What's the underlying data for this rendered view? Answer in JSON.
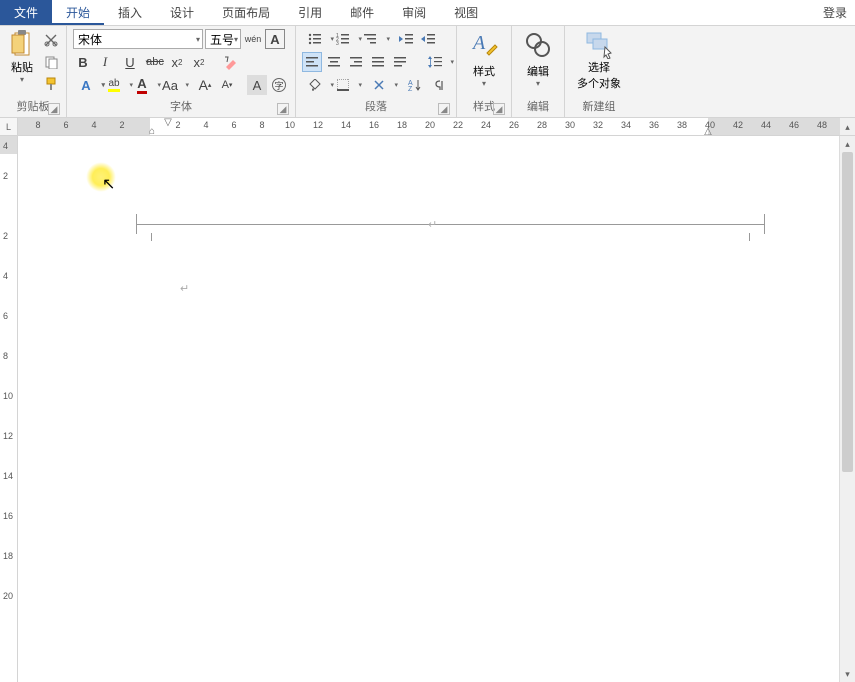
{
  "menu": {
    "file": "文件",
    "home": "开始",
    "insert": "插入",
    "design": "设计",
    "layout": "页面布局",
    "references": "引用",
    "mail": "邮件",
    "review": "审阅",
    "view": "视图",
    "login": "登录"
  },
  "ribbon": {
    "clipboard": {
      "label": "剪贴板",
      "paste": "粘贴"
    },
    "font": {
      "label": "字体",
      "name": "宋体",
      "size": "五号",
      "pinyin": "wén",
      "bold": "B",
      "italic": "I",
      "underline": "U",
      "strike": "abc",
      "sub": "x",
      "sup": "x",
      "textfx": "A",
      "highlight": "ab",
      "fontcolor": "A",
      "changecase": "Aa",
      "grow": "A",
      "shrink": "A",
      "charshade": "A",
      "charborder": "字"
    },
    "paragraph": {
      "label": "段落"
    },
    "styles": {
      "label": "样式",
      "btn": "样式"
    },
    "edit": {
      "label": "编辑",
      "btn": "编辑"
    },
    "newgroup": {
      "label": "新建组",
      "line1": "选择",
      "line2": "多个对象"
    }
  },
  "ruler": {
    "corner": "L",
    "h": [
      "8",
      "6",
      "4",
      "2",
      "2",
      "4",
      "6",
      "8",
      "10",
      "12",
      "14",
      "16",
      "18",
      "20",
      "22",
      "24",
      "26",
      "28",
      "30",
      "32",
      "34",
      "36",
      "38",
      "40",
      "42",
      "44",
      "46",
      "48"
    ],
    "v": [
      "4",
      "2",
      "2",
      "4",
      "6",
      "8",
      "10",
      "12",
      "14",
      "16",
      "18",
      "20"
    ]
  }
}
